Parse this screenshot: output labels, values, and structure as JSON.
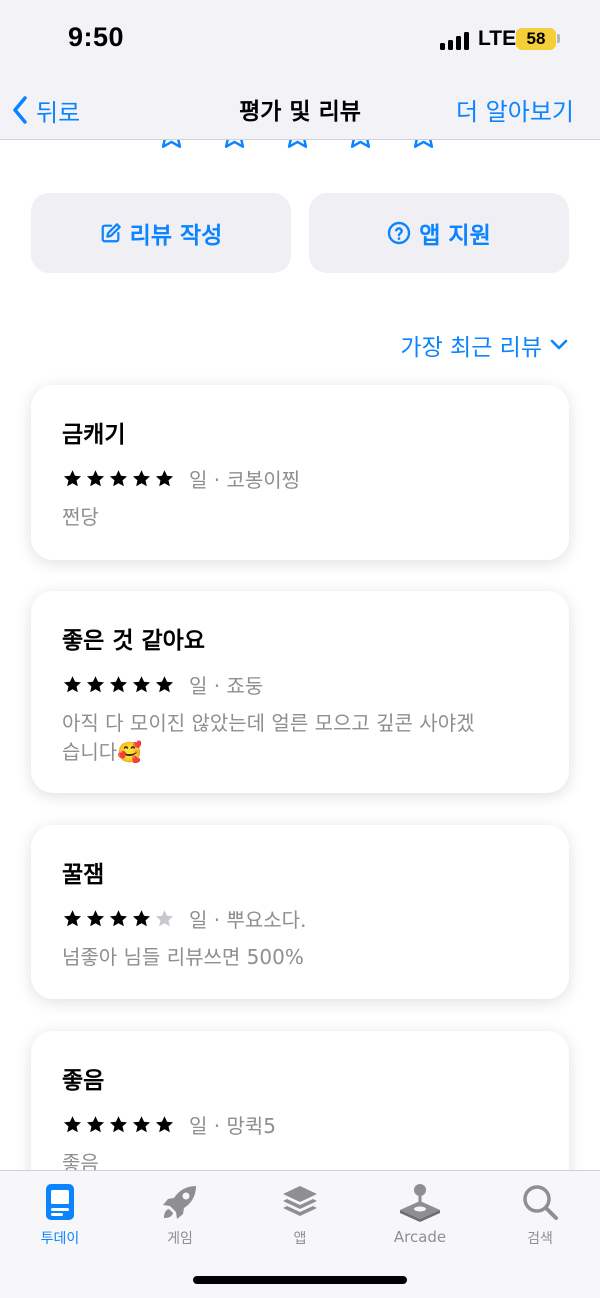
{
  "status_bar": {
    "time": "9:50",
    "network": "LTE",
    "battery": "58"
  },
  "nav": {
    "back_label": "뒤로",
    "title": "평가 및 리뷰",
    "more_label": "더 알아보기"
  },
  "actions": {
    "write_review": "리뷰 작성",
    "app_support": "앱 지원"
  },
  "sort": {
    "label": "가장 최근 리뷰"
  },
  "colors": {
    "accent": "#0a84ff",
    "secondary_text": "#8e8e93",
    "star_filled": "#000000",
    "star_empty": "#c7c7cc"
  },
  "reviews": [
    {
      "title": "금캐기",
      "rating": 5,
      "meta": "일 · 코봉이찡",
      "body": "쩐당"
    },
    {
      "title": "좋은 것 같아요",
      "rating": 5,
      "meta": "일 · 죠둥",
      "body": "아직 다 모이진 않았는데 얼른 모으고 깊콘 사야겠습니다🥰"
    },
    {
      "title": "꿀잼",
      "rating": 4,
      "meta": "일 · 뿌요소다.",
      "body": "넘좋아 님들 리뷰쓰면 500%"
    },
    {
      "title": "좋음",
      "rating": 5,
      "meta": "일 · 망퀵5",
      "body": "좋음"
    }
  ],
  "tabs": [
    {
      "label": "투데이",
      "icon": "today-icon",
      "active": true
    },
    {
      "label": "게임",
      "icon": "rocket-icon",
      "active": false
    },
    {
      "label": "앱",
      "icon": "apps-stack-icon",
      "active": false
    },
    {
      "label": "Arcade",
      "icon": "joystick-icon",
      "active": false
    },
    {
      "label": "검색",
      "icon": "search-icon",
      "active": false
    }
  ]
}
